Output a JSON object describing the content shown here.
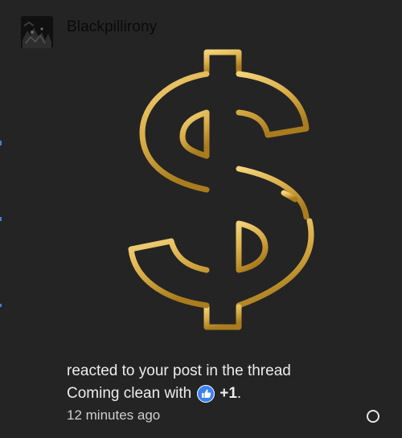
{
  "notification": {
    "username": "Blackpillirony",
    "action_text": "reacted to your post in the thread",
    "thread_title": "Coming clean with",
    "reaction_icon": "thumbs-up-icon",
    "reaction_count": "+1",
    "trailing_punct": ".",
    "timestamp": "12 minutes ago",
    "hero_icon": "dollar-sign-icon"
  },
  "colors": {
    "background": "#242424",
    "gold_light": "#f3d27a",
    "gold_dark": "#a97c1e",
    "reaction_blue": "#3b82f0",
    "text": "#ececec"
  }
}
